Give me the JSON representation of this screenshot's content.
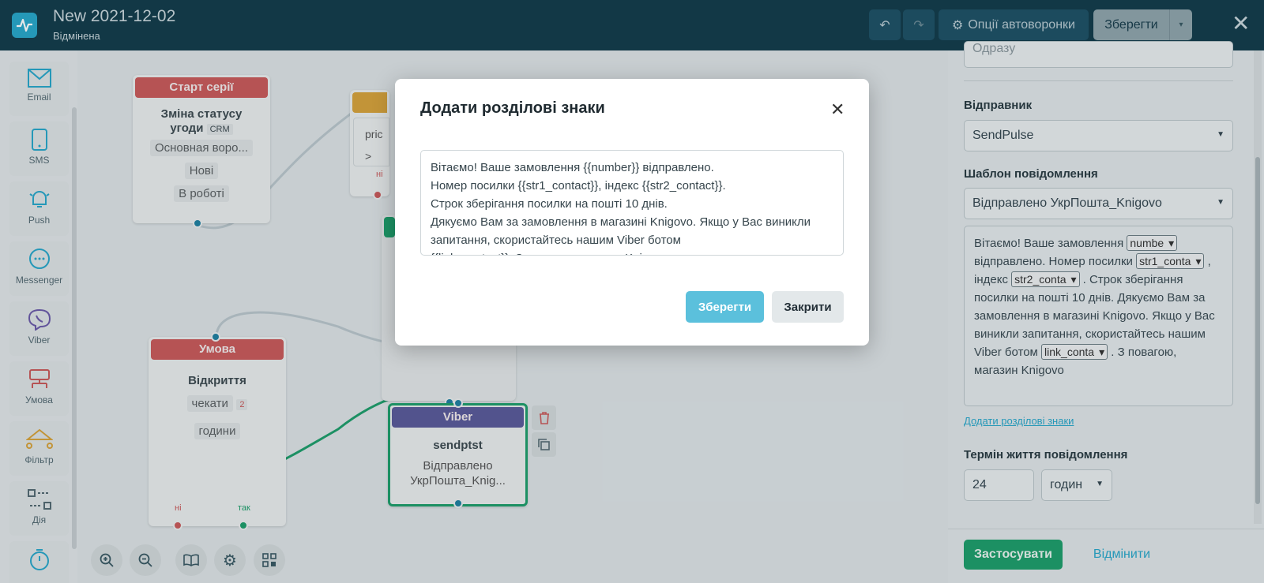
{
  "header": {
    "title": "New 2021-12-02",
    "status": "Відмінена",
    "options_label": "Опції автоворонки",
    "save_label": "Зберегти"
  },
  "sidebar": {
    "tools": [
      {
        "label": "Email",
        "icon": "email-icon"
      },
      {
        "label": "SMS",
        "icon": "sms-icon"
      },
      {
        "label": "Push",
        "icon": "push-icon"
      },
      {
        "label": "Messenger",
        "icon": "messenger-icon"
      },
      {
        "label": "Viber",
        "icon": "viber-icon"
      },
      {
        "label": "Умова",
        "icon": "condition-icon"
      },
      {
        "label": "Фільтр",
        "icon": "filter-icon"
      },
      {
        "label": "Дія",
        "icon": "action-icon"
      }
    ]
  },
  "canvas": {
    "start_node": {
      "header": "Старт серії",
      "title": "Зміна статусу угоди",
      "badge": "CRM",
      "pipeline": "Основная воро...",
      "from": "Нові",
      "to": "В роботі"
    },
    "partial_node": {
      "field": "pric",
      "no": "ні"
    },
    "condition_node": {
      "header": "Умова",
      "title": "Відкриття",
      "wait": "чекати",
      "wait_count": "2",
      "unit": "години",
      "no": "ні",
      "yes": "так"
    },
    "viber_node": {
      "header": "Viber",
      "name": "sendptst",
      "template": "Відправлено УкрПошта_Knig..."
    }
  },
  "right_panel": {
    "top_value": "Одразу",
    "sender_label": "Відправник",
    "sender_value": "SendPulse",
    "template_label": "Шаблон повідомлення",
    "template_value": "Відправлено УкрПошта_Knigovo",
    "template_body": {
      "part1": "Вітаємо! Ваше замовлення",
      "sel1": "numbe",
      "part2": "відправлено. Номер посилки",
      "sel2": "str1_conta",
      "part3": ", індекс",
      "sel3": "str2_conta",
      "part4": ". Строк зберігання посилки на пошті 10 днів. Дякуємо Вам за замовлення в магазині Knigovo. Якщо у Вас виникли запитання, скористайтесь нашим Viber ботом",
      "sel4": "link_conta",
      "part5": ". З повагою, магазин Knigovo"
    },
    "add_punct_link": "Додати розділові знаки",
    "lifetime_label": "Термін життя повідомлення",
    "lifetime_value": "24",
    "lifetime_unit": "годин",
    "apply_label": "Застосувати",
    "cancel_label": "Відмінити"
  },
  "modal": {
    "title": "Додати розділові знаки",
    "text": "Вітаємо! Ваше замовлення {{number}} відправлено.\nНомер посилки {{str1_contact}}, індекс {{str2_contact}}.\nСтрок зберігання посилки на пошті 10 днів.\nДякуємо Вам за замовлення в магазині Knigovo. Якщо у Вас виникли запитання, скористайтесь нашим Viber ботом\n{{link_contact}}. З повагою, магазин Knigovo",
    "save_label": "Зберегти",
    "close_label": "Закрити"
  },
  "colors": {
    "header_bg": "#123b4a",
    "accent": "#27a6c9",
    "start_red": "#c95a5a",
    "viber_purple": "#5a5a99",
    "green": "#1e9e6a"
  }
}
